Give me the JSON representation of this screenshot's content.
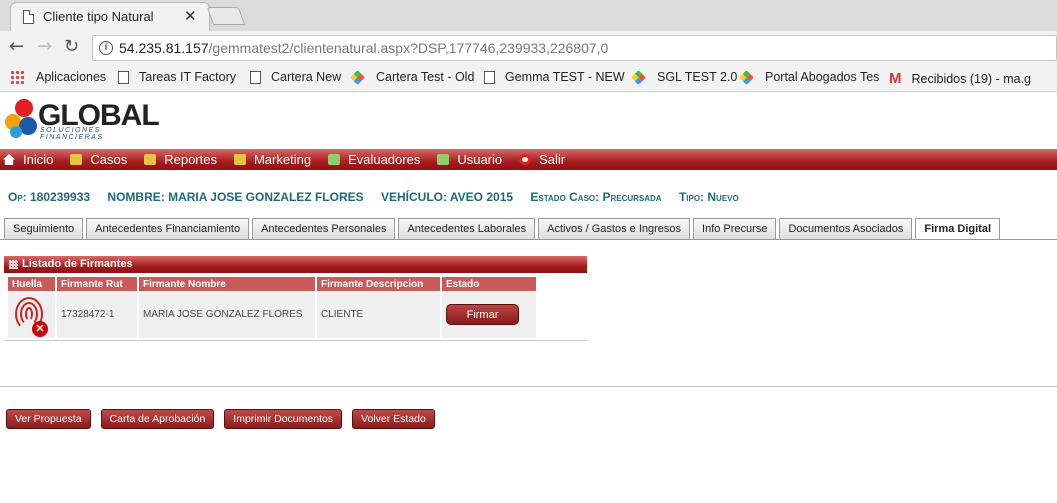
{
  "browser": {
    "tab_title": "Cliente tipo Natural",
    "url_host": "54.235.81.157",
    "url_path": "/gemmatest2/clientenatural.aspx?DSP,177746,239933,226807,0",
    "bookmarks": [
      {
        "label": "Aplicaciones",
        "icon": "apps-icon"
      },
      {
        "label": "Tareas IT Factory",
        "icon": "page-icon"
      },
      {
        "label": "Cartera New",
        "icon": "page-icon"
      },
      {
        "label": "Cartera Test - Old",
        "icon": "star-icon"
      },
      {
        "label": "Gemma TEST - NEW",
        "icon": "page-icon"
      },
      {
        "label": "SGL TEST 2.0",
        "icon": "star-icon"
      },
      {
        "label": "Portal Abogados Tes",
        "icon": "star-icon"
      },
      {
        "label": "Recibidos (19) - ma.g",
        "icon": "gmail-icon"
      }
    ]
  },
  "logo": {
    "brand": "GLOBAL",
    "tagline": "SOLUCIONES FINANCIERAS"
  },
  "menu": [
    {
      "label": "Inicio",
      "icon": "home-icon"
    },
    {
      "label": "Casos",
      "icon": "folder-icon"
    },
    {
      "label": "Reportes",
      "icon": "folder-icon"
    },
    {
      "label": "Marketing",
      "icon": "mail-icon"
    },
    {
      "label": "Evaluadores",
      "icon": "evaluators-icon"
    },
    {
      "label": "Usuario",
      "icon": "user-icon"
    },
    {
      "label": "Salir",
      "icon": "exit-icon"
    }
  ],
  "case": {
    "op": "Op: 180239933",
    "nombre": "NOMBRE: MARIA JOSE GONZALEZ FLORES",
    "vehiculo": "VEHÍCULO: AVEO 2015",
    "estado": "Estado Caso: Precursada",
    "tipo": "Tipo: Nuevo"
  },
  "tabs": [
    {
      "label": "Seguimiento"
    },
    {
      "label": "Antecedentes Financiamiento"
    },
    {
      "label": "Antecedentes Personales"
    },
    {
      "label": "Antecedentes Laborales"
    },
    {
      "label": "Activos / Gastos e Ingresos"
    },
    {
      "label": "Info Precurse"
    },
    {
      "label": "Documentos Asociados"
    },
    {
      "label": "Firma Digital",
      "active": true
    }
  ],
  "firmantes": {
    "title": "Listado de Firmantes",
    "columns": [
      "Huella",
      "Firmante Rut",
      "Firmante Nombre",
      "Firmante Descripcion",
      "Estado"
    ],
    "rows": [
      {
        "rut": "17328472-1",
        "nombre": "MARIA JOSE GONZALEZ FLORES",
        "descripcion": "CLIENTE",
        "action": "Firmar"
      }
    ]
  },
  "actions": [
    "Ver Propuesta",
    "Carta de Aprobación",
    "Imprimir Documentos",
    "Volver Estado"
  ]
}
